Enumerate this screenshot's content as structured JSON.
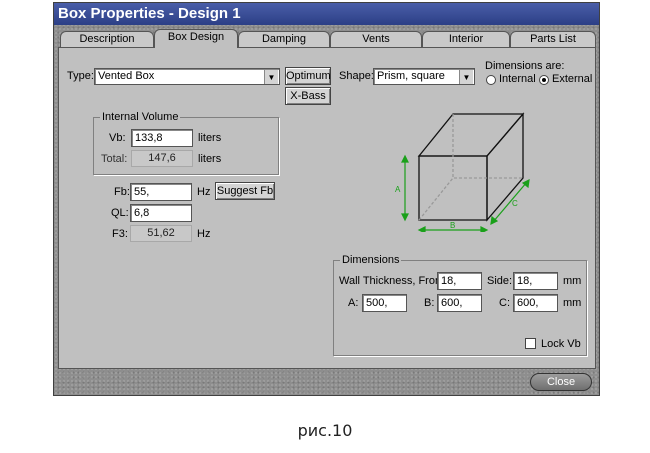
{
  "window": {
    "title": "Box Properties - Design 1"
  },
  "tabs": [
    {
      "label": "Description",
      "active": false
    },
    {
      "label": "Box Design",
      "active": true
    },
    {
      "label": "Damping",
      "active": false
    },
    {
      "label": "Vents",
      "active": false
    },
    {
      "label": "Interior",
      "active": false
    },
    {
      "label": "Parts List",
      "active": false
    }
  ],
  "type_field": {
    "label": "Type:",
    "value": "Vented Box"
  },
  "buttons": {
    "optimum": "Optimum",
    "xbass": "X-Bass",
    "suggest_fb": "Suggest Fb",
    "close": "Close"
  },
  "shape_field": {
    "label": "Shape:",
    "value": "Prism, square"
  },
  "dimensions_are": {
    "label": "Dimensions are:",
    "internal": "Internal",
    "external": "External",
    "selected": "External"
  },
  "internal_volume": {
    "title": "Internal Volume",
    "vb_label": "Vb:",
    "vb_value": "133,8",
    "vb_unit": "liters",
    "total_label": "Total:",
    "total_value": "147,6",
    "total_unit": "liters"
  },
  "tuning": {
    "fb_label": "Fb:",
    "fb_value": "55,",
    "fb_unit": "Hz",
    "ql_label": "QL:",
    "ql_value": "6,8",
    "f3_label": "F3:",
    "f3_value": "51,62",
    "f3_unit": "Hz"
  },
  "diagram": {
    "a": "A",
    "b": "B",
    "c": "C",
    "color": "#1aa01a"
  },
  "dimensions": {
    "title": "Dimensions",
    "wall_front_label": "Wall Thickness, Front:",
    "wall_front_value": "18,",
    "side_label": "Side:",
    "side_value": "18,",
    "mm1": "mm",
    "a_label": "A:",
    "a_value": "500,",
    "b_label": "B:",
    "b_value": "600,",
    "c_label": "C:",
    "c_value": "600,",
    "mm2": "mm",
    "lock_vb_label": "Lock Vb",
    "lock_vb_checked": false
  },
  "caption": "рис.10"
}
